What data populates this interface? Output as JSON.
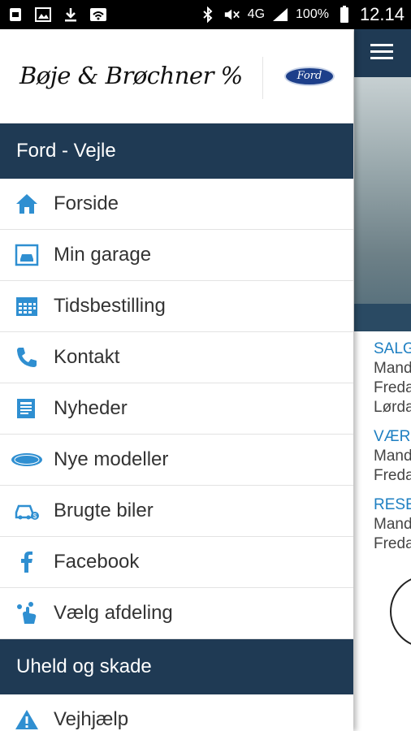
{
  "status_bar": {
    "battery_percent": "100%",
    "time": "12.14",
    "network": "4G",
    "icons": [
      "sim-icon",
      "image-icon",
      "download-icon",
      "wifi-icon",
      "bluetooth-icon",
      "mute-icon",
      "signal-icon",
      "battery-icon"
    ]
  },
  "drawer": {
    "dealer_logo": "Bøje & Brøchner %",
    "brand_logo": "Ford",
    "section1": "Ford - Vejle",
    "items": [
      {
        "label": "Forside",
        "icon": "home-icon"
      },
      {
        "label": "Min garage",
        "icon": "car-garage-icon"
      },
      {
        "label": "Tidsbestilling",
        "icon": "calendar-icon"
      },
      {
        "label": "Kontakt",
        "icon": "phone-icon"
      },
      {
        "label": "Nyheder",
        "icon": "news-icon"
      },
      {
        "label": "Nye modeller",
        "icon": "ford-oval-icon"
      },
      {
        "label": "Brugte biler",
        "icon": "used-car-icon"
      },
      {
        "label": "Facebook",
        "icon": "facebook-icon"
      },
      {
        "label": "Vælg afdeling",
        "icon": "select-location-icon"
      }
    ],
    "section2": "Uheld og skade",
    "items2": [
      {
        "label": "Vejhjælp",
        "icon": "warning-icon"
      }
    ]
  },
  "background": {
    "lines": [
      "SALG",
      "Mand",
      "Freda",
      "Lørda",
      "VÆR",
      "Mand",
      "Freda",
      "RESE",
      "Mand",
      "Freda"
    ]
  },
  "colors": {
    "primary_dark": "#1f3a54",
    "accent_blue": "#1e7fc2"
  }
}
